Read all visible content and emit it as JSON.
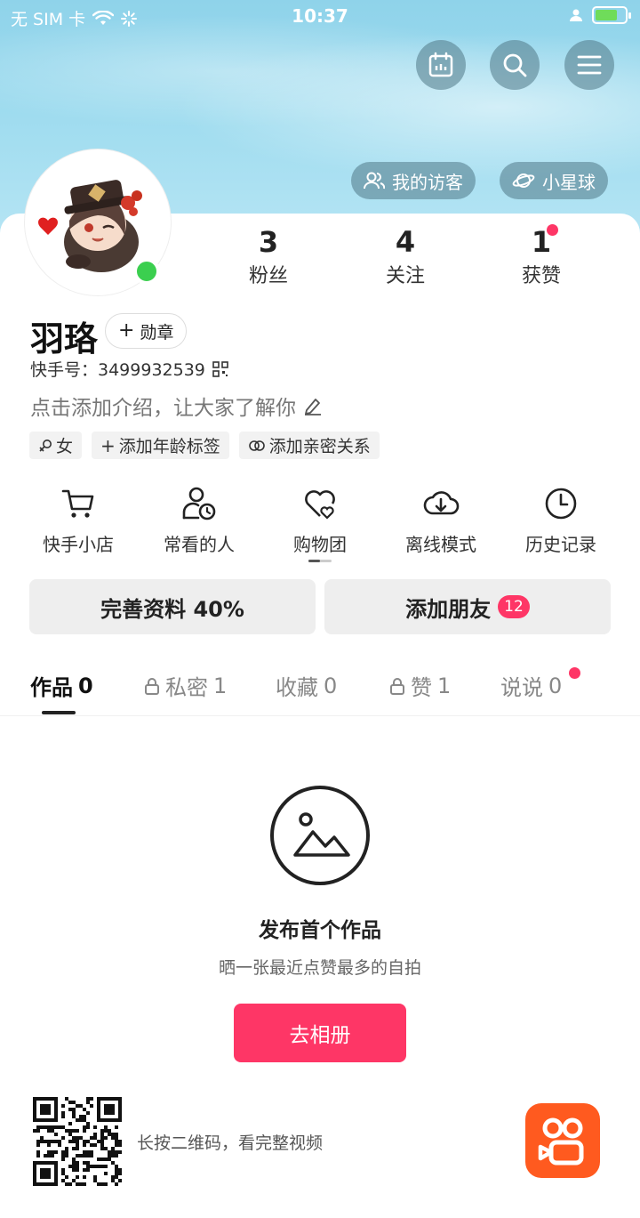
{
  "status_bar": {
    "carrier": "无 SIM 卡",
    "time": "10:37"
  },
  "header": {
    "visitors_label": "我的访客",
    "planet_label": "小星球"
  },
  "profile": {
    "name": "羽珞",
    "medal_label": "勋章",
    "kuaishou_id_label": "快手号：3499932539",
    "intro_placeholder": "点击添加介绍，让大家了解你",
    "tags": [
      "女",
      "添加年龄标签",
      "添加亲密关系"
    ]
  },
  "stats": [
    {
      "value": "3",
      "label": "粉丝"
    },
    {
      "value": "4",
      "label": "关注"
    },
    {
      "value": "1",
      "label": "获赞"
    }
  ],
  "tools": [
    {
      "label": "快手小店",
      "icon": "cart-icon"
    },
    {
      "label": "常看的人",
      "icon": "person-clock-icon"
    },
    {
      "label": "购物团",
      "icon": "heart-shop-icon"
    },
    {
      "label": "离线模式",
      "icon": "cloud-download-icon"
    },
    {
      "label": "历史记录",
      "icon": "clock-icon"
    }
  ],
  "actions": {
    "complete_profile": "完善资料 40%",
    "add_friends": "添加朋友",
    "add_friends_badge": "12"
  },
  "tabs": [
    {
      "label": "作品",
      "count": "0"
    },
    {
      "label": "私密",
      "count": "1"
    },
    {
      "label": "收藏",
      "count": "0"
    },
    {
      "label": "赞",
      "count": "1"
    },
    {
      "label": "说说",
      "count": "0"
    }
  ],
  "empty": {
    "title": "发布首个作品",
    "subtitle": "晒一张最近点赞最多的自拍",
    "button": "去相册"
  },
  "footer": {
    "qr_hint": "长按二维码，看完整视频"
  },
  "colors": {
    "accent": "#fe3666",
    "online": "#3bcf4f",
    "brand": "#ff5a1f"
  }
}
